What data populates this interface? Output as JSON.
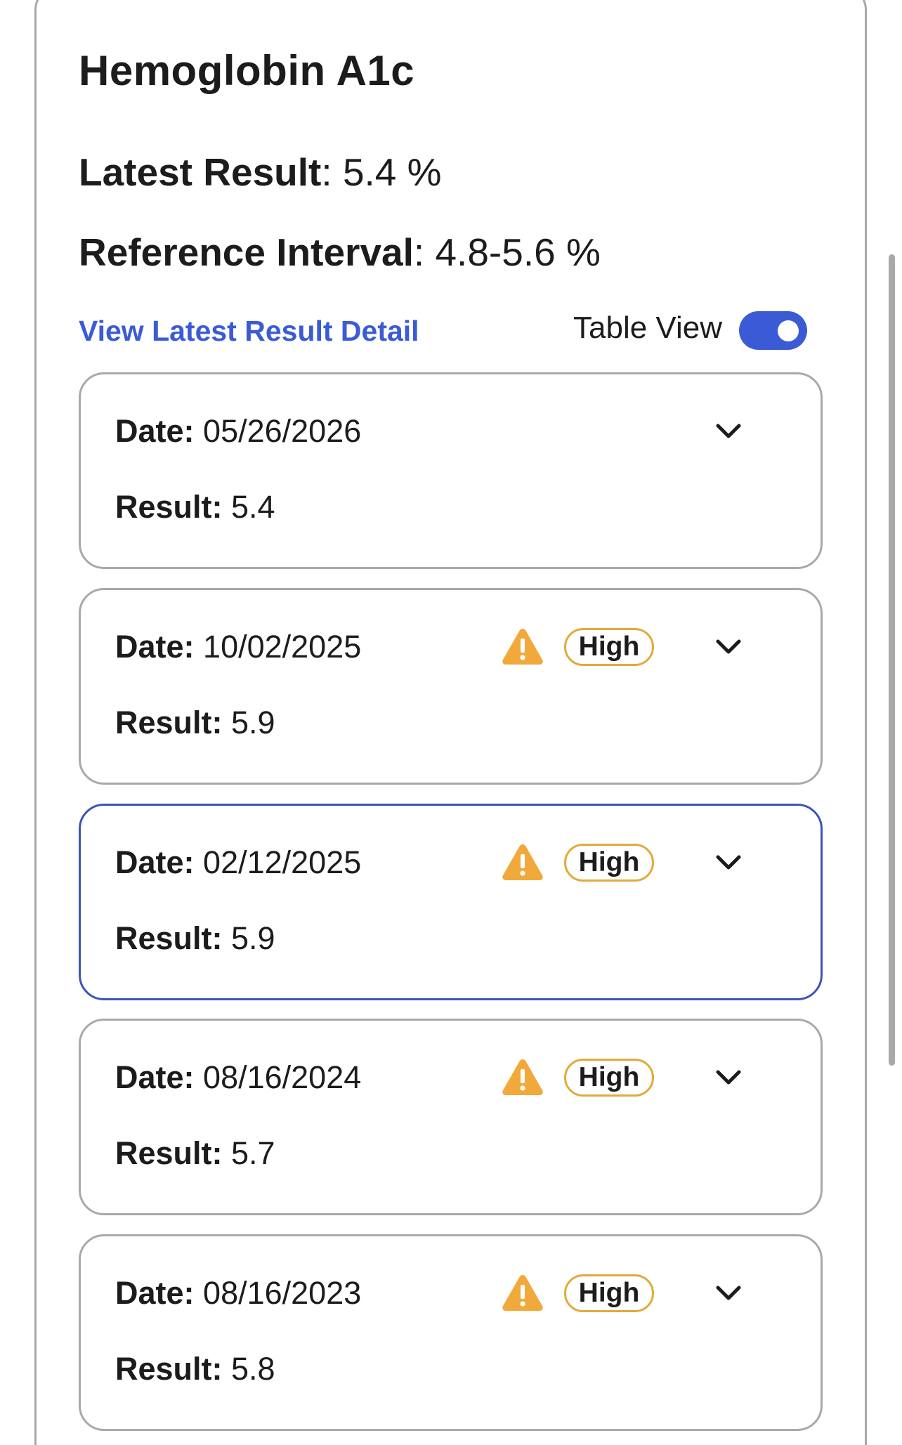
{
  "test": {
    "title": "Hemoglobin A1c",
    "latest_label": "Latest Result",
    "latest_value": "5.4 %",
    "reference_label": "Reference Interval",
    "reference_value": "4.8-5.6 %"
  },
  "controls": {
    "detail_link": "View Latest Result Detail",
    "table_view_label": "Table View",
    "table_view_on": true
  },
  "card_labels": {
    "date": "Date:",
    "result": "Result:"
  },
  "results": [
    {
      "date": "05/26/2026",
      "result": "5.4",
      "flag": null
    },
    {
      "date": "10/02/2025",
      "result": "5.9",
      "flag": "High"
    },
    {
      "date": "02/12/2025",
      "result": "5.9",
      "flag": "High"
    },
    {
      "date": "08/16/2024",
      "result": "5.7",
      "flag": "High"
    },
    {
      "date": "08/16/2023",
      "result": "5.8",
      "flag": "High"
    }
  ],
  "icons": {
    "warning": "warning-triangle-icon",
    "expand": "chevron-down-icon"
  },
  "colors": {
    "accent": "#3b5bd6",
    "warning": "#f2a93b",
    "badge_border": "#e2aa3a",
    "selected_border": "#3b55b8"
  }
}
